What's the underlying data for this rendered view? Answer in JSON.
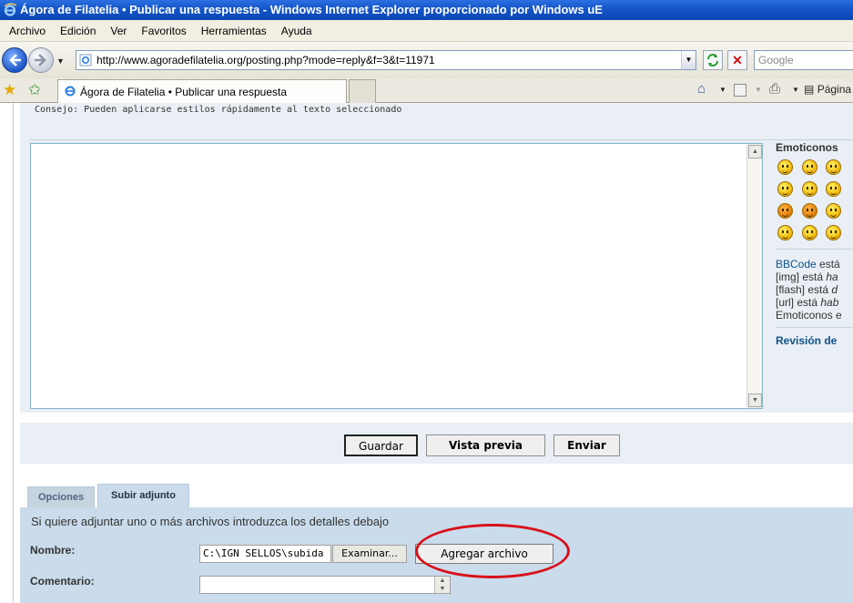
{
  "window": {
    "title": "Ágora de Filatelia • Publicar una respuesta - Windows Internet Explorer proporcionado por Windows uE"
  },
  "menu": [
    "Archivo",
    "Edición",
    "Ver",
    "Favoritos",
    "Herramientas",
    "Ayuda"
  ],
  "address": {
    "url": "http://www.agoradefilatelia.org/posting.php?mode=reply&f=3&t=11971",
    "search_placeholder": "Google"
  },
  "tab": {
    "title": "Ágora de Filatelia • Publicar una respuesta"
  },
  "commandbar": {
    "page_label": "Página"
  },
  "editor": {
    "tip": "Consejo: Pueden aplicarse estilos rápidamente al texto seleccionado",
    "body": ""
  },
  "sidebar": {
    "emoticons_title": "Emoticonos",
    "smileys": [
      "smile-icon",
      "grin-icon",
      "sad-icon",
      "cool-icon",
      "laugh-icon",
      "worried-icon",
      "evil-icon",
      "twisted-icon",
      "rolleyes-icon",
      "idea-icon",
      "arrow-icon",
      "neutral-icon"
    ],
    "bbcode_link": "BBCode",
    "bbcode_rest": " está",
    "img_line_a": "[img] está ",
    "img_line_b": "ha",
    "flash_line_a": "[flash] está ",
    "flash_line_b": "d",
    "url_line_a": "[url] está ",
    "url_line_b": "hab",
    "emoticons_line": "Emoticonos e",
    "revision": "Revisión de"
  },
  "buttons": {
    "save": "Guardar",
    "preview": "Vista previa",
    "submit": "Enviar"
  },
  "tabs": {
    "options": "Opciones",
    "upload": "Subir adjunto"
  },
  "attach": {
    "help": "Si quiere adjuntar uno o más archivos introduzca los detalles debajo",
    "name_label": "Nombre:",
    "file_value": "C:\\IGN SELLOS\\subida",
    "browse": "Examinar...",
    "add_file": "Agregar archivo",
    "comment_label": "Comentario:"
  },
  "colors": {
    "annotation": "#d8101a",
    "panel": "#e9eff4",
    "attach_panel": "#cadceb",
    "link": "#105289"
  }
}
